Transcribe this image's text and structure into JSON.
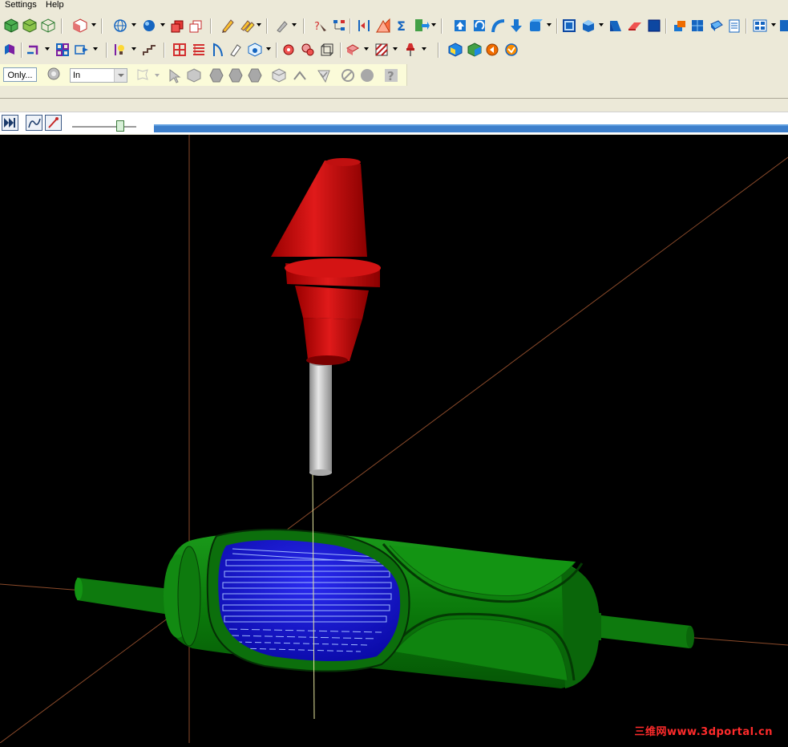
{
  "menu": {
    "settings": "Settings",
    "help": "Help"
  },
  "toolbar": {
    "only_button": "Only...",
    "scope_select": "In",
    "icons_row1": [
      "box-green-icon",
      "box-green2-icon",
      "box-wire-icon",
      "box-red-icon",
      "globe-icon",
      "sphere-icon",
      "cube-red-icon",
      "cube-outline-icon",
      "pencil-icon",
      "pencil-multi-icon",
      "tool-gray-icon",
      "question-arrow-icon",
      "tree-icon",
      "trim-icon",
      "surface-orange-icon",
      "sigma-icon",
      "export-green-icon",
      "arrow-up-blue-icon",
      "rotate-blue-icon",
      "curve-blue-icon",
      "arrow-down-blue-icon",
      "box-blue-icon",
      "view-front-icon",
      "view-iso-icon",
      "view-side-icon",
      "view-flat-icon",
      "view-back-icon",
      "layers-icon",
      "grid-blue-icon",
      "shell-icon",
      "list-icon",
      "panel-icon"
    ],
    "icons_row2": [
      "axis-icon",
      "corner-icon",
      "grid4-icon",
      "arrow-box-icon",
      "lamp-icon",
      "stairs-icon",
      "frame-red-icon",
      "lines-red-icon",
      "profile-icon",
      "brush-icon",
      "cube-gear-icon",
      "gear-red-icon",
      "gear2-red-icon",
      "cube-wire-icon",
      "stamp-icon",
      "hatch-icon",
      "tool-holder-icon",
      "simulate1-icon",
      "simulate2-icon",
      "sim-orange-icon",
      "sim-check-icon"
    ],
    "icons_row3": [
      "select-gear-icon",
      "select-arrow-icon",
      "select-cube-icon",
      "filter1-icon",
      "filter2-icon",
      "filter3-icon",
      "filter-box-icon",
      "filter-wave-icon",
      "filter-check-icon",
      "cancel-icon",
      "dot-icon",
      "help-icon"
    ]
  },
  "simulation": {
    "play_end_icon": "fast-forward-icon",
    "tool_icon": "tool-path-icon",
    "pen_icon": "red-pen-icon",
    "speed_fraction": 0.72,
    "progress_fraction": 1.0
  },
  "viewport": {
    "background": "#000000",
    "tool_holder_color": "#cc1010",
    "tool_shank_color": "#c8c8c8",
    "part_color": "#0e7a0e",
    "pocket_color": "#1a1ad8",
    "toolpath_color": "#9fb8ff",
    "axis_color": "#8a4a2a",
    "watermark": "三维网www.3dportal.cn",
    "watermark_color": "#ff2b2b"
  }
}
